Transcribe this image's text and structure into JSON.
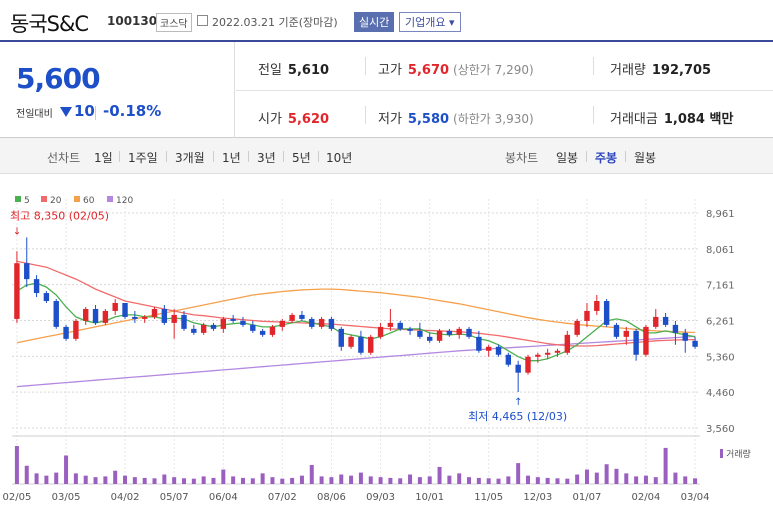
{
  "header": {
    "name": "동국S&C",
    "code": "100130",
    "market": "코스닥",
    "date": "2022.03.21 기준(장마감)",
    "realtime": "실시간",
    "company_info": "기업개요"
  },
  "quote": {
    "price": "5,600",
    "change_label": "전일대비",
    "change": "10",
    "change_pct": "-0.18%",
    "prev_label": "전일",
    "prev": "5,610",
    "high_label": "고가",
    "high": "5,670",
    "upper_limit": "(상한가 7,290)",
    "volume_label": "거래량",
    "volume": "192,705",
    "open_label": "시가",
    "open": "5,620",
    "low_label": "저가",
    "low": "5,580",
    "lower_limit": "(하한가 3,930)",
    "amount_label": "거래대금",
    "amount": "1,084 백만"
  },
  "toolbar": {
    "line_label": "선차트",
    "line_periods": [
      "1일",
      "1주일",
      "3개월",
      "1년",
      "3년",
      "5년",
      "10년"
    ],
    "candle_label": "봉차트",
    "candle_periods": [
      "일봉",
      "주봉",
      "월봉"
    ],
    "selected_candle": "주봉"
  },
  "colors": {
    "up": "#e0262b",
    "down": "#1d4fc8",
    "ma5": "#4caf50",
    "ma20": "#f26b6b",
    "ma60": "#f5a04a",
    "ma120": "#b488e0",
    "volume": "#9b5fc0"
  },
  "chart_data": {
    "type": "candlestick",
    "interval": "weekly",
    "legend": [
      {
        "name": "5",
        "color": "#4caf50"
      },
      {
        "name": "20",
        "color": "#f26b6b"
      },
      {
        "name": "60",
        "color": "#f5a04a"
      },
      {
        "name": "120",
        "color": "#b488e0"
      }
    ],
    "y_ticks": [
      "8,961",
      "8,061",
      "7,161",
      "6,261",
      "5,360",
      "4,460",
      "3,560"
    ],
    "y_range": [
      3560,
      8961
    ],
    "x_ticks": [
      "02/05",
      "03/05",
      "04/02",
      "05/07",
      "06/04",
      "07/02",
      "08/06",
      "09/03",
      "10/01",
      "11/05",
      "12/03",
      "01/07",
      "02/04",
      "03/04"
    ],
    "high_annotation": "최고 8,350 (02/05)",
    "low_annotation": "최저 4,465 (12/03)",
    "volume_label": "거래량",
    "candles": [
      {
        "o": 6300,
        "h": 8000,
        "l": 6200,
        "c": 7700
      },
      {
        "o": 7700,
        "h": 8350,
        "l": 7100,
        "c": 7300
      },
      {
        "o": 7300,
        "h": 7400,
        "l": 6850,
        "c": 6950
      },
      {
        "o": 6950,
        "h": 7000,
        "l": 6700,
        "c": 6750
      },
      {
        "o": 6750,
        "h": 6800,
        "l": 6050,
        "c": 6100
      },
      {
        "o": 6100,
        "h": 6150,
        "l": 5750,
        "c": 5800
      },
      {
        "o": 5800,
        "h": 6300,
        "l": 5750,
        "c": 6250
      },
      {
        "o": 6250,
        "h": 6600,
        "l": 6150,
        "c": 6550
      },
      {
        "o": 6550,
        "h": 6650,
        "l": 6150,
        "c": 6200
      },
      {
        "o": 6200,
        "h": 6550,
        "l": 6150,
        "c": 6500
      },
      {
        "o": 6500,
        "h": 6800,
        "l": 6400,
        "c": 6700
      },
      {
        "o": 6700,
        "h": 6700,
        "l": 6300,
        "c": 6350
      },
      {
        "o": 6350,
        "h": 6500,
        "l": 6200,
        "c": 6300
      },
      {
        "o": 6300,
        "h": 6400,
        "l": 6200,
        "c": 6350
      },
      {
        "o": 6350,
        "h": 6600,
        "l": 6300,
        "c": 6550
      },
      {
        "o": 6550,
        "h": 6650,
        "l": 6150,
        "c": 6200
      },
      {
        "o": 6200,
        "h": 6550,
        "l": 5800,
        "c": 6400
      },
      {
        "o": 6400,
        "h": 6500,
        "l": 6000,
        "c": 6050
      },
      {
        "o": 6050,
        "h": 6150,
        "l": 5900,
        "c": 5950
      },
      {
        "o": 5950,
        "h": 6200,
        "l": 5900,
        "c": 6150
      },
      {
        "o": 6150,
        "h": 6200,
        "l": 6000,
        "c": 6050
      },
      {
        "o": 6050,
        "h": 6350,
        "l": 5950,
        "c": 6300
      },
      {
        "o": 6300,
        "h": 6400,
        "l": 6200,
        "c": 6250
      },
      {
        "o": 6250,
        "h": 6350,
        "l": 6100,
        "c": 6150
      },
      {
        "o": 6150,
        "h": 6250,
        "l": 5950,
        "c": 6000
      },
      {
        "o": 6000,
        "h": 6050,
        "l": 5850,
        "c": 5900
      },
      {
        "o": 5900,
        "h": 6150,
        "l": 5850,
        "c": 6100
      },
      {
        "o": 6100,
        "h": 6300,
        "l": 6000,
        "c": 6250
      },
      {
        "o": 6250,
        "h": 6450,
        "l": 6200,
        "c": 6400
      },
      {
        "o": 6400,
        "h": 6500,
        "l": 6250,
        "c": 6300
      },
      {
        "o": 6300,
        "h": 6350,
        "l": 6050,
        "c": 6100
      },
      {
        "o": 6100,
        "h": 6350,
        "l": 6050,
        "c": 6300
      },
      {
        "o": 6300,
        "h": 6350,
        "l": 6000,
        "c": 6050
      },
      {
        "o": 6050,
        "h": 6100,
        "l": 5500,
        "c": 5600
      },
      {
        "o": 5600,
        "h": 5900,
        "l": 5550,
        "c": 5850
      },
      {
        "o": 5850,
        "h": 6000,
        "l": 5400,
        "c": 5450
      },
      {
        "o": 5450,
        "h": 5900,
        "l": 5400,
        "c": 5850
      },
      {
        "o": 5850,
        "h": 6200,
        "l": 5800,
        "c": 6100
      },
      {
        "o": 6100,
        "h": 6550,
        "l": 6000,
        "c": 6200
      },
      {
        "o": 6200,
        "h": 6250,
        "l": 6000,
        "c": 6050
      },
      {
        "o": 6050,
        "h": 6100,
        "l": 5900,
        "c": 6000
      },
      {
        "o": 6000,
        "h": 6200,
        "l": 5800,
        "c": 5850
      },
      {
        "o": 5850,
        "h": 5950,
        "l": 5700,
        "c": 5750
      },
      {
        "o": 5750,
        "h": 6050,
        "l": 5700,
        "c": 6000
      },
      {
        "o": 6000,
        "h": 6050,
        "l": 5850,
        "c": 5900
      },
      {
        "o": 5900,
        "h": 6100,
        "l": 5800,
        "c": 6050
      },
      {
        "o": 6050,
        "h": 6100,
        "l": 5800,
        "c": 5850
      },
      {
        "o": 5850,
        "h": 6000,
        "l": 5450,
        "c": 5500
      },
      {
        "o": 5500,
        "h": 5650,
        "l": 5350,
        "c": 5600
      },
      {
        "o": 5600,
        "h": 5650,
        "l": 5350,
        "c": 5400
      },
      {
        "o": 5400,
        "h": 5450,
        "l": 5100,
        "c": 5150
      },
      {
        "o": 5150,
        "h": 5250,
        "l": 4465,
        "c": 4950
      },
      {
        "o": 4950,
        "h": 5400,
        "l": 4900,
        "c": 5350
      },
      {
        "o": 5350,
        "h": 5450,
        "l": 5200,
        "c": 5400
      },
      {
        "o": 5400,
        "h": 5550,
        "l": 5300,
        "c": 5450
      },
      {
        "o": 5450,
        "h": 5550,
        "l": 5350,
        "c": 5500
      },
      {
        "o": 5450,
        "h": 6000,
        "l": 5400,
        "c": 5900
      },
      {
        "o": 5900,
        "h": 6300,
        "l": 5850,
        "c": 6250
      },
      {
        "o": 6250,
        "h": 6700,
        "l": 6100,
        "c": 6500
      },
      {
        "o": 6500,
        "h": 6900,
        "l": 6400,
        "c": 6750
      },
      {
        "o": 6750,
        "h": 6800,
        "l": 6100,
        "c": 6150
      },
      {
        "o": 6150,
        "h": 6200,
        "l": 5800,
        "c": 5850
      },
      {
        "o": 5850,
        "h": 6100,
        "l": 5650,
        "c": 6000
      },
      {
        "o": 6000,
        "h": 6050,
        "l": 5250,
        "c": 5400
      },
      {
        "o": 5400,
        "h": 6150,
        "l": 5350,
        "c": 6100
      },
      {
        "o": 6100,
        "h": 6550,
        "l": 6050,
        "c": 6350
      },
      {
        "o": 6350,
        "h": 6450,
        "l": 6100,
        "c": 6150
      },
      {
        "o": 6150,
        "h": 6250,
        "l": 5650,
        "c": 5950
      },
      {
        "o": 5950,
        "h": 6050,
        "l": 5450,
        "c": 5750
      },
      {
        "o": 5750,
        "h": 5850,
        "l": 5550,
        "c": 5600
      }
    ],
    "ma5": [
      7000,
      7150,
      7200,
      7100,
      6900,
      6600,
      6350,
      6250,
      6200,
      6250,
      6350,
      6400,
      6400,
      6350,
      6350,
      6300,
      6320,
      6300,
      6200,
      6150,
      6100,
      6150,
      6180,
      6200,
      6150,
      6100,
      6100,
      6150,
      6200,
      6250,
      6200,
      6150,
      6100,
      5950,
      5900,
      5850,
      5800,
      5850,
      5950,
      6050,
      6050,
      6050,
      5950,
      5920,
      5900,
      5920,
      5900,
      5800,
      5750,
      5650,
      5500,
      5350,
      5250,
      5250,
      5300,
      5400,
      5500,
      5650,
      5850,
      6050,
      6250,
      6300,
      6250,
      6100,
      5950,
      5950,
      6000,
      5950,
      5900,
      5850
    ],
    "ma20": [
      7750,
      7700,
      7650,
      7600,
      7500,
      7400,
      7300,
      7180,
      7050,
      6950,
      6850,
      6750,
      6700,
      6650,
      6600,
      6550,
      6500,
      6450,
      6400,
      6380,
      6350,
      6320,
      6300,
      6280,
      6260,
      6240,
      6230,
      6220,
      6210,
      6200,
      6190,
      6180,
      6170,
      6150,
      6130,
      6110,
      6090,
      6070,
      6050,
      6040,
      6030,
      6020,
      6010,
      6000,
      5990,
      5980,
      5960,
      5940,
      5910,
      5880,
      5840,
      5800,
      5760,
      5720,
      5680,
      5650,
      5630,
      5620,
      5620,
      5630,
      5650,
      5670,
      5690,
      5710,
      5730,
      5750,
      5760,
      5770,
      5780,
      5780
    ],
    "ma60": [
      5700,
      5750,
      5800,
      5850,
      5900,
      5950,
      6000,
      6050,
      6100,
      6150,
      6200,
      6250,
      6300,
      6350,
      6400,
      6450,
      6500,
      6550,
      6600,
      6650,
      6700,
      6750,
      6800,
      6850,
      6900,
      6930,
      6960,
      6990,
      7010,
      7030,
      7040,
      7050,
      7050,
      7040,
      7020,
      7000,
      6980,
      6960,
      6930,
      6900,
      6870,
      6840,
      6800,
      6760,
      6720,
      6680,
      6630,
      6580,
      6530,
      6480,
      6430,
      6380,
      6330,
      6290,
      6250,
      6220,
      6190,
      6160,
      6140,
      6120,
      6100,
      6080,
      6060,
      6040,
      6020,
      6000,
      5990,
      5980,
      5970,
      5960
    ],
    "ma120": [
      4600,
      4620,
      4640,
      4660,
      4680,
      4700,
      4720,
      4740,
      4760,
      4780,
      4800,
      4820,
      4840,
      4860,
      4880,
      4900,
      4920,
      4940,
      4960,
      4980,
      5000,
      5020,
      5040,
      5060,
      5080,
      5100,
      5120,
      5140,
      5160,
      5180,
      5200,
      5220,
      5240,
      5260,
      5280,
      5300,
      5320,
      5340,
      5360,
      5380,
      5400,
      5420,
      5440,
      5460,
      5480,
      5500,
      5515,
      5530,
      5545,
      5560,
      5575,
      5590,
      5605,
      5620,
      5635,
      5650,
      5665,
      5680,
      5695,
      5710,
      5725,
      5740,
      5755,
      5770,
      5785,
      5800,
      5815,
      5830,
      5845,
      5860
    ],
    "volumes": [
      100,
      48,
      28,
      22,
      30,
      75,
      28,
      22,
      18,
      20,
      35,
      22,
      18,
      16,
      15,
      25,
      18,
      15,
      14,
      20,
      16,
      38,
      20,
      16,
      15,
      28,
      18,
      14,
      16,
      22,
      50,
      20,
      18,
      25,
      22,
      30,
      20,
      18,
      16,
      15,
      25,
      18,
      20,
      45,
      22,
      28,
      18,
      16,
      15,
      14,
      20,
      55,
      22,
      18,
      16,
      15,
      14,
      25,
      38,
      30,
      52,
      40,
      28,
      20,
      22,
      18,
      95,
      30,
      20,
      15
    ]
  }
}
